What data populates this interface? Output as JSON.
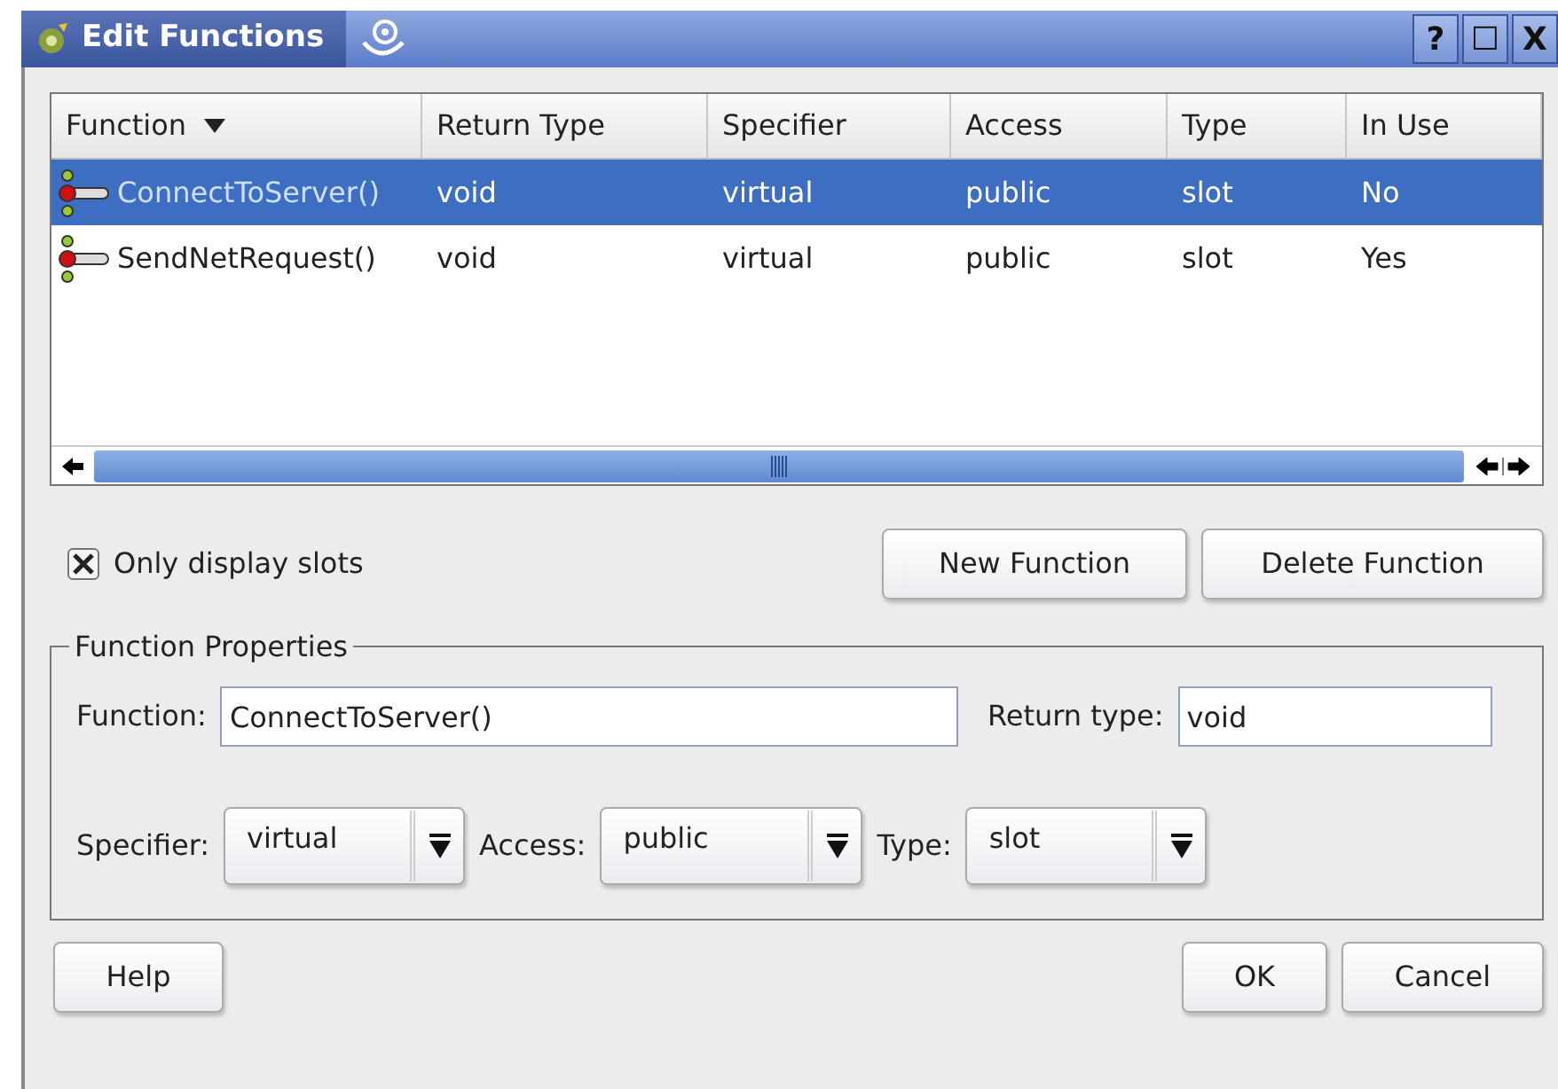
{
  "window": {
    "title": "Edit Functions",
    "buttons": [
      "?",
      "☐",
      "X"
    ]
  },
  "table": {
    "columns": [
      {
        "label": "Function",
        "sorted": true
      },
      {
        "label": "Return Type",
        "sorted": false
      },
      {
        "label": "Specifier",
        "sorted": false
      },
      {
        "label": "Access",
        "sorted": false
      },
      {
        "label": "Type",
        "sorted": false
      },
      {
        "label": "In Use",
        "sorted": false
      }
    ],
    "rows": [
      {
        "selected": true,
        "cells": [
          "ConnectToServer()",
          "void",
          "virtual",
          "public",
          "slot",
          "No"
        ]
      },
      {
        "selected": false,
        "cells": [
          "SendNetRequest()",
          "void",
          "virtual",
          "public",
          "slot",
          "Yes"
        ]
      }
    ]
  },
  "only_display_slots": {
    "label": "Only display slots",
    "checked": true
  },
  "actions": [
    "New Function",
    "Delete Function"
  ],
  "properties": {
    "title": "Function Properties",
    "function": {
      "label": "Function:",
      "value": "ConnectToServer()"
    },
    "return_type": {
      "label": "Return type:",
      "value": "void"
    },
    "combos": [
      {
        "label": "Specifier:",
        "value": "virtual"
      },
      {
        "label": "Access:",
        "value": "public"
      },
      {
        "label": "Type:",
        "value": "slot"
      }
    ]
  },
  "footer": {
    "left": [
      "Help"
    ],
    "right": [
      "OK",
      "Cancel"
    ]
  }
}
